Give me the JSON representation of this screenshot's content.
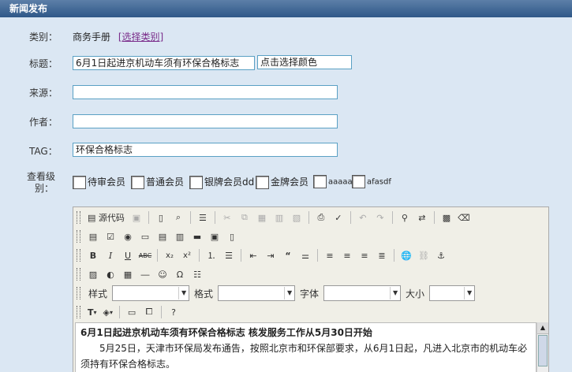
{
  "title": "新闻发布",
  "form": {
    "category_label": "类别：",
    "category_value": "商务手册",
    "choose_category": "[选择类别]",
    "headline_label": "标题：",
    "headline_value": "6月1日起进京机动车须有环保合格标志",
    "color_picker": "点击选择颜色",
    "source_label": "来源：",
    "source_value": "",
    "author_label": "作者：",
    "author_value": "",
    "tag_label": "TAG：",
    "tag_value": "环保合格标志",
    "level_label_1": "查看级",
    "level_label_2": "别：",
    "levels": [
      "待审会员",
      "普通会员",
      "银牌会员dd",
      "金牌会员",
      "aaaaa",
      "afasdf"
    ]
  },
  "toolbar": {
    "source_code": "源代码",
    "style_label": "样式",
    "format_label": "格式",
    "font_label": "字体",
    "size_label": "大小",
    "style_value": "",
    "format_value": "",
    "font_value": "",
    "size_value": ""
  },
  "editor": {
    "heading": "6月1日起进京机动车须有环保合格标志 核发服务工作从5月30日开始",
    "paragraph": "5月25日，天津市环保局发布通告，按照北京市和环保部要求，从6月1日起，凡进入北京市的机动车必须持有环保合格标志。"
  }
}
